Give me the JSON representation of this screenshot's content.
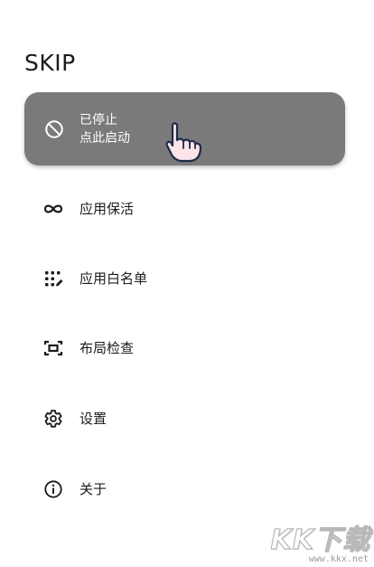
{
  "app": {
    "title": "SKIP"
  },
  "status_card": {
    "line1": "已停止",
    "line2": "点此启动",
    "icon": "block-icon",
    "background": "#7a7a7a"
  },
  "menu": [
    {
      "label": "应用保活",
      "icon": "infinity-icon"
    },
    {
      "label": "应用白名单",
      "icon": "app-grid-edit-icon"
    },
    {
      "label": "布局检查",
      "icon": "layout-inspect-icon"
    },
    {
      "label": "设置",
      "icon": "gear-icon"
    },
    {
      "label": "关于",
      "icon": "info-icon"
    }
  ],
  "watermark": {
    "logo": "KK下载",
    "url": "www.kkx.net"
  }
}
